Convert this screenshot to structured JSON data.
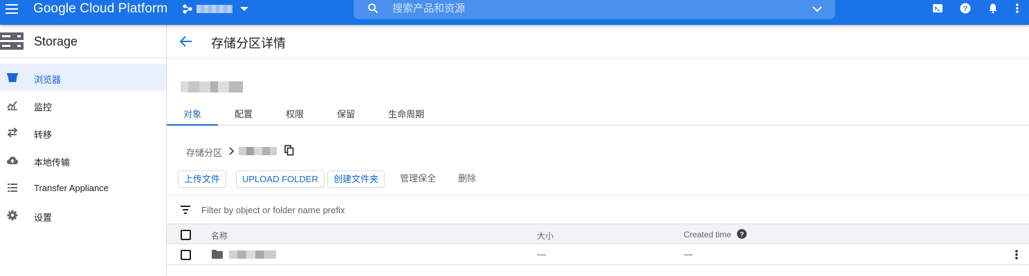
{
  "topbar": {
    "brand": "Google Cloud Platform",
    "search_placeholder": "搜索产品和资源"
  },
  "sidebar": {
    "title": "Storage",
    "items": [
      {
        "label": "浏览器",
        "icon": "bucket-icon",
        "active": true
      },
      {
        "label": "监控",
        "icon": "monitoring-chart-icon",
        "active": false
      },
      {
        "label": "转移",
        "icon": "transfer-arrows-icon",
        "active": false
      },
      {
        "label": "本地传输",
        "icon": "cloud-upload-icon",
        "active": false
      },
      {
        "label": "Transfer Appliance",
        "icon": "list-icon",
        "active": false
      },
      {
        "label": "设置",
        "icon": "gear-icon",
        "active": false
      }
    ]
  },
  "main": {
    "page_title": "存储分区详情",
    "tabs": [
      {
        "label": "对象",
        "active": true
      },
      {
        "label": "配置",
        "active": false
      },
      {
        "label": "权限",
        "active": false
      },
      {
        "label": "保留",
        "active": false
      },
      {
        "label": "生命周期",
        "active": false
      }
    ],
    "breadcrumb_root": "存储分区",
    "actions": {
      "upload_files": "上传文件",
      "upload_folder": "UPLOAD FOLDER",
      "create_folder": "创建文件夹",
      "manage_holds": "管理保全",
      "delete": "删除"
    },
    "filter_placeholder": "Filter by object or folder name prefix",
    "table": {
      "columns": {
        "name": "名称",
        "size": "大小",
        "created": "Created time"
      },
      "rows": [
        {
          "size": "—",
          "created": "—"
        }
      ]
    }
  },
  "colors": {
    "brand_blue": "#1a73e8",
    "active_blue": "#1967d2",
    "active_bg": "#e8f0fe"
  }
}
